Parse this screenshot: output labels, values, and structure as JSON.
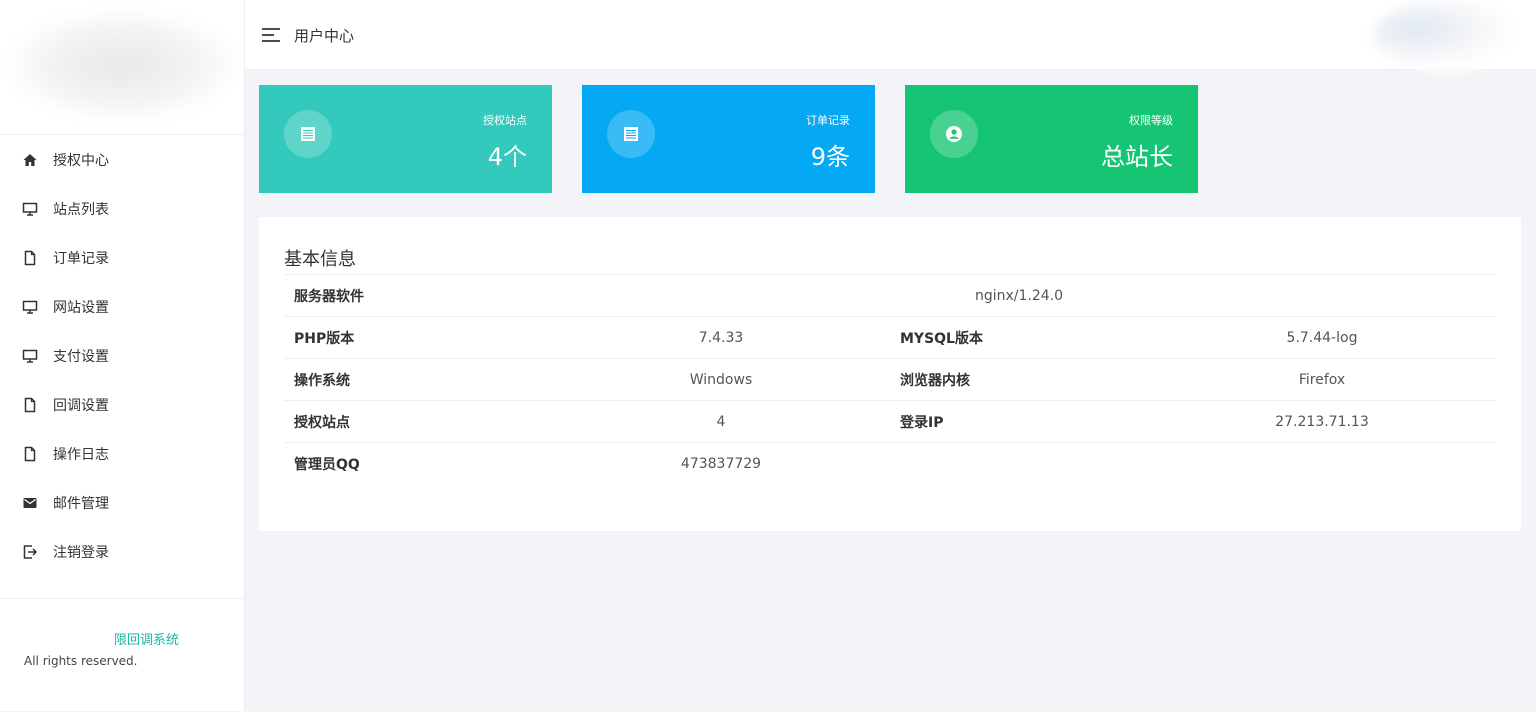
{
  "header": {
    "title": "用户中心"
  },
  "sidebar": {
    "items": [
      {
        "label": "授权中心",
        "icon": "home-icon"
      },
      {
        "label": "站点列表",
        "icon": "monitor-icon"
      },
      {
        "label": "订单记录",
        "icon": "file-icon"
      },
      {
        "label": "网站设置",
        "icon": "monitor-icon"
      },
      {
        "label": "支付设置",
        "icon": "monitor-icon"
      },
      {
        "label": "回调设置",
        "icon": "file-icon"
      },
      {
        "label": "操作日志",
        "icon": "file-icon"
      },
      {
        "label": "邮件管理",
        "icon": "mail-icon"
      },
      {
        "label": "注销登录",
        "icon": "logout-icon"
      }
    ],
    "footer": {
      "brand": "限回调系统",
      "copyright": "All rights reserved."
    }
  },
  "stats": [
    {
      "label": "授权站点",
      "value": "4个",
      "color": "#33c9bc",
      "icon": "list-icon"
    },
    {
      "label": "订单记录",
      "value": "9条",
      "color": "#05a8f3",
      "icon": "list-icon"
    },
    {
      "label": "权限等级",
      "value": "总站长",
      "color": "#16c574",
      "icon": "user-icon"
    }
  ],
  "info": {
    "title": "基本信息",
    "server_label": "服务器软件",
    "server_value": "nginx/1.24.0",
    "php_label": "PHP版本",
    "php_value": "7.4.33",
    "mysql_label": "MYSQL版本",
    "mysql_value": "5.7.44-log",
    "os_label": "操作系统",
    "os_value": "Windows",
    "browser_label": "浏览器内核",
    "browser_value": "Firefox",
    "sites_label": "授权站点",
    "sites_value": "4",
    "ip_label": "登录IP",
    "ip_value": "27.213.71.13",
    "qq_label": "管理员QQ",
    "qq_value": "473837729"
  }
}
